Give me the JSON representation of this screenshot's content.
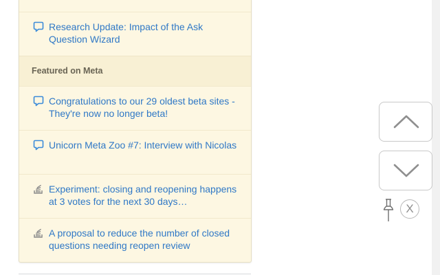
{
  "sidebar": {
    "top_items": [
      {
        "icon": "speech-bubble-icon",
        "title": "Research Update: Impact of the Ask Question Wizard"
      }
    ],
    "featured_meta": {
      "header": "Featured on Meta",
      "items": [
        {
          "icon": "speech-bubble-icon",
          "title": "Congratulations to our 29 oldest beta sites - They're now no longer beta!"
        },
        {
          "icon": "speech-bubble-icon",
          "title": "Unicorn Meta Zoo #7: Interview with Nicolas"
        },
        {
          "icon": "stack-exchange-logo-icon",
          "title": "Experiment: closing and reopening happens at 3 votes for the next 30 days…"
        },
        {
          "icon": "stack-exchange-logo-icon",
          "title": "A proposal to reduce the number of closed questions needing reopen review"
        }
      ]
    }
  },
  "scroll_controls": {
    "up_icon": "chevron-up-icon",
    "down_icon": "chevron-down-icon",
    "pin_icon": "pushpin-icon",
    "close_label": "X"
  },
  "colors": {
    "sidebar_bg": "#fdf7e2",
    "header_bg": "#f8f0d4",
    "link": "#2f78c6",
    "icon_blue": "#3b8bd9"
  }
}
